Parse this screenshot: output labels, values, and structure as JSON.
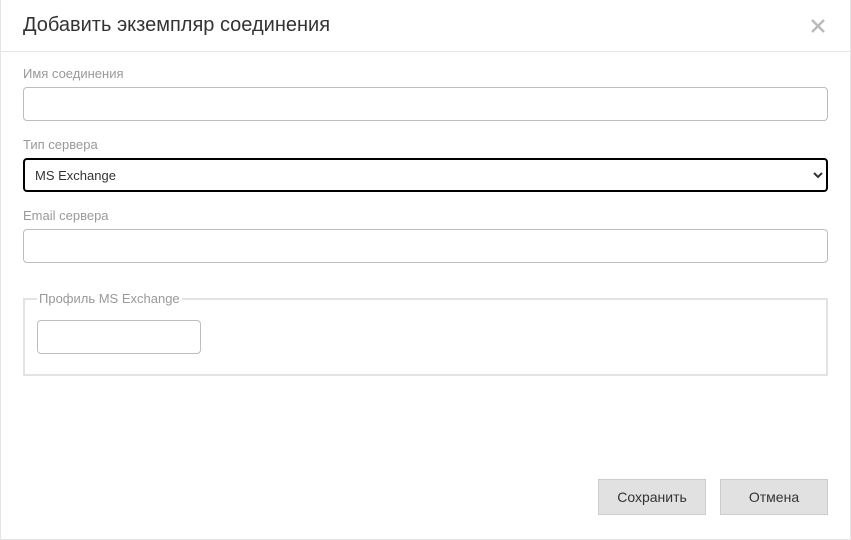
{
  "dialog": {
    "title": "Добавить экземпляр соединения"
  },
  "form": {
    "connection_name": {
      "label": "Имя соединения",
      "value": ""
    },
    "server_type": {
      "label": "Тип сервера",
      "selected": "MS Exchange",
      "options": [
        "MS Exchange"
      ]
    },
    "server_email": {
      "label": "Email сервера",
      "value": ""
    },
    "exchange_profile": {
      "legend": "Профиль MS Exchange",
      "value": ""
    }
  },
  "buttons": {
    "save": "Сохранить",
    "cancel": "Отмена"
  }
}
